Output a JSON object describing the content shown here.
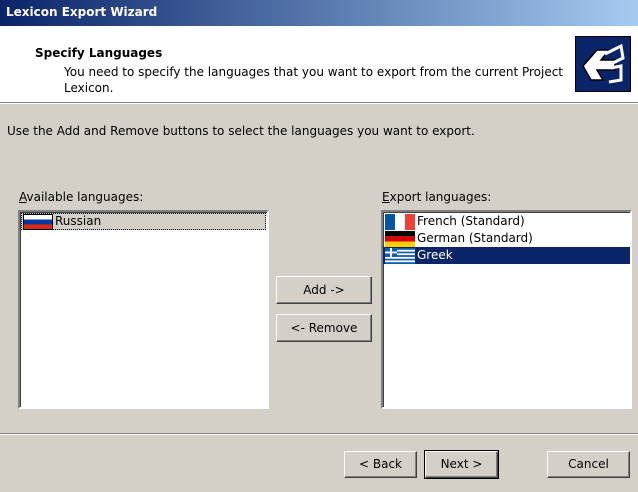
{
  "window": {
    "title": "Lexicon Export Wizard"
  },
  "header": {
    "title": "Specify Languages",
    "description": "You need to specify the languages that you want to export from the current Project Lexicon.",
    "icon": "wizard-export-icon"
  },
  "instruction": "Use the Add and Remove buttons to select the languages you want to export.",
  "available": {
    "label_accel": "A",
    "label_rest": "vailable languages:",
    "items": [
      {
        "label": "Russian",
        "flag": "russia-flag-icon"
      }
    ]
  },
  "export": {
    "label_accel": "E",
    "label_rest": "xport languages:",
    "items": [
      {
        "label": "French (Standard)",
        "flag": "france-flag-icon"
      },
      {
        "label": "German (Standard)",
        "flag": "germany-flag-icon"
      },
      {
        "label": "Greek",
        "flag": "greece-flag-icon",
        "selected": true
      }
    ]
  },
  "buttons": {
    "add": "Add ->",
    "remove": "<- Remove",
    "back": "< Back",
    "next": "Next >",
    "cancel": "Cancel"
  },
  "colors": {
    "title_start": "#0a246a",
    "title_end": "#a6caf0",
    "selection": "#0a246a",
    "face": "#d4d0c8"
  }
}
